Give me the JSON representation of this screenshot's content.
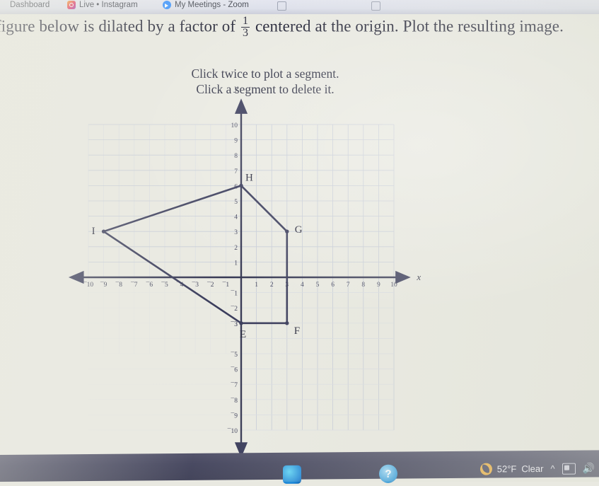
{
  "browser": {
    "tabs": [
      {
        "label": "Dashboard",
        "icon": "none"
      },
      {
        "label": "Live • Instagram",
        "icon": "instagram-icon"
      },
      {
        "label": "My Meetings - Zoom",
        "icon": "zoom-icon"
      }
    ]
  },
  "question": {
    "text_before": "figure below is dilated by a factor of",
    "fraction_numerator": "1",
    "fraction_denominator": "3",
    "text_after": "centered at the origin. Plot the resulting image."
  },
  "hints": {
    "line1": "Click twice to plot a segment.",
    "line2": "Click a segment to delete it."
  },
  "chart_data": {
    "type": "scatter",
    "title": "",
    "xlabel": "x",
    "ylabel": "y",
    "xlim": [
      -10,
      10
    ],
    "ylim": [
      -10,
      10
    ],
    "grid": true,
    "x_ticks": [
      "-10",
      "-9",
      "-8",
      "-7",
      "-6",
      "-5",
      "-4",
      "-3",
      "-2",
      "-1",
      "1",
      "2",
      "3",
      "4",
      "5",
      "6",
      "7",
      "8",
      "9",
      "10"
    ],
    "y_ticks": [
      "10",
      "9",
      "8",
      "7",
      "6",
      "5",
      "4",
      "3",
      "2",
      "1",
      "-1",
      "-2",
      "-3",
      "-5",
      "-6",
      "-7",
      "-8",
      "-9",
      "-10"
    ],
    "points": [
      {
        "label": "H",
        "x": 0,
        "y": 6
      },
      {
        "label": "G",
        "x": 3,
        "y": 3
      },
      {
        "label": "F",
        "x": 3,
        "y": -3
      },
      {
        "label": "E",
        "x": 0,
        "y": -3
      },
      {
        "label": "I",
        "x": -9,
        "y": 3
      }
    ],
    "segments": [
      {
        "from": "I",
        "to": "H"
      },
      {
        "from": "H",
        "to": "G"
      },
      {
        "from": "G",
        "to": "F"
      },
      {
        "from": "F",
        "to": "E"
      },
      {
        "from": "E",
        "to": "I"
      }
    ]
  },
  "taskbar": {
    "weather_temp": "52°F",
    "weather_condition": "Clear",
    "weather_icon": "moon-icon",
    "overflow_icon": "chevron-up-icon",
    "tray_icons": [
      "display-icon",
      "volume-icon"
    ],
    "app_icons": [
      "edge-icon",
      "help-icon"
    ]
  },
  "colors": {
    "page_bg": "#e9e9e1",
    "ink": "#2f3152",
    "grid": "#c3c9d6",
    "taskbar": "#3f4059"
  }
}
